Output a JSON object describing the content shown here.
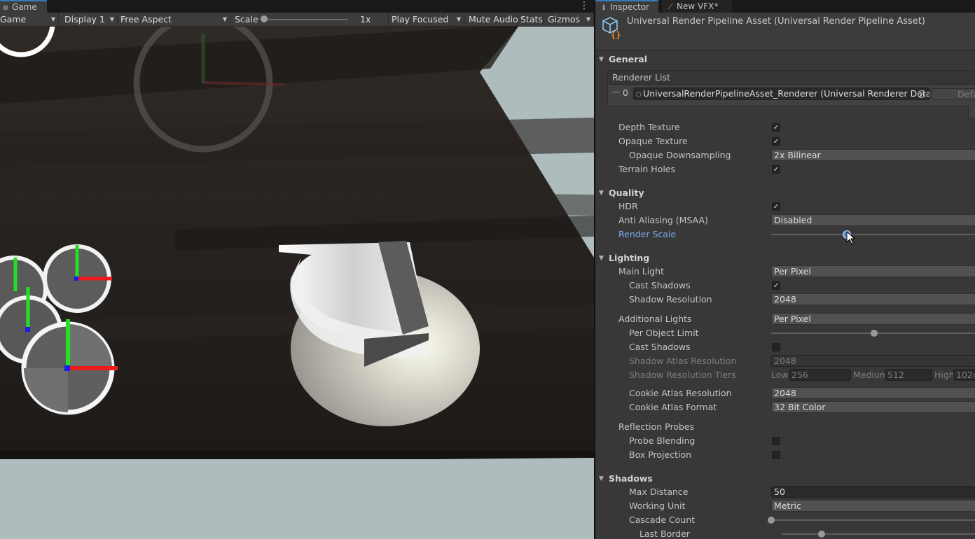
{
  "game": {
    "tab_label": "Game",
    "toolbar": {
      "mode": "Game",
      "display": "Display 1",
      "aspect": "Free Aspect",
      "scale_label": "Scale",
      "scale_value": "1x",
      "play_mode": "Play Focused",
      "mute": "Mute Audio",
      "stats": "Stats",
      "gizmos": "Gizmos"
    }
  },
  "inspector": {
    "tab_label": "Inspector",
    "vfx_tab_label": "New VFX*",
    "title": "Universal Render Pipeline Asset (Universal Render Pipeline Asset)",
    "sections": {
      "general": "General",
      "quality": "Quality",
      "lighting": "Lighting",
      "shadows": "Shadows"
    },
    "renderer_list": {
      "header": "Renderer List",
      "index": "0",
      "value": "UniversalRenderPipelineAsset_Renderer (Universal Renderer Data)",
      "default_label": "Default"
    },
    "fields": {
      "depth_texture": {
        "label": "Depth Texture",
        "checked": true
      },
      "opaque_texture": {
        "label": "Opaque Texture",
        "checked": true
      },
      "opaque_downsampling": {
        "label": "Opaque Downsampling",
        "value": "2x Bilinear"
      },
      "terrain_holes": {
        "label": "Terrain Holes",
        "checked": true
      },
      "hdr": {
        "label": "HDR",
        "checked": true
      },
      "msaa": {
        "label": "Anti Aliasing (MSAA)",
        "value": "Disabled"
      },
      "render_scale": {
        "label": "Render Scale",
        "slider_fraction": 0.36
      },
      "main_light": {
        "label": "Main Light",
        "value": "Per Pixel"
      },
      "main_cast_shadows": {
        "label": "Cast Shadows",
        "checked": true
      },
      "shadow_resolution": {
        "label": "Shadow Resolution",
        "value": "2048"
      },
      "additional_lights": {
        "label": "Additional Lights",
        "value": "Per Pixel"
      },
      "per_object_limit": {
        "label": "Per Object Limit",
        "slider_fraction": 0.49
      },
      "add_cast_shadows": {
        "label": "Cast Shadows",
        "checked": false
      },
      "shadow_atlas_resolution": {
        "label": "Shadow Atlas Resolution",
        "value": "2048"
      },
      "shadow_resolution_tiers": {
        "label": "Shadow Resolution Tiers",
        "low_label": "Low",
        "low_value": "256",
        "medium_label": "Medium",
        "medium_value": "512",
        "high_label": "High",
        "high_value": "1024"
      },
      "cookie_atlas_resolution": {
        "label": "Cookie Atlas Resolution",
        "value": "2048"
      },
      "cookie_atlas_format": {
        "label": "Cookie Atlas Format",
        "value": "32 Bit Color"
      },
      "reflection_probes": {
        "label": "Reflection Probes"
      },
      "probe_blending": {
        "label": "Probe Blending",
        "checked": false
      },
      "box_projection": {
        "label": "Box Projection",
        "checked": false
      },
      "max_distance": {
        "label": "Max Distance",
        "value": "50"
      },
      "working_unit": {
        "label": "Working Unit",
        "value": "Metric"
      },
      "cascade_count": {
        "label": "Cascade Count",
        "slider_fraction": 0.0
      },
      "last_border": {
        "label": "Last Border",
        "slider_fraction": 0.2
      }
    }
  },
  "colors": {
    "accent": "#3a79bb",
    "highlight_label": "#7aacee",
    "panel": "#383838",
    "sky": "#aebcbd"
  }
}
